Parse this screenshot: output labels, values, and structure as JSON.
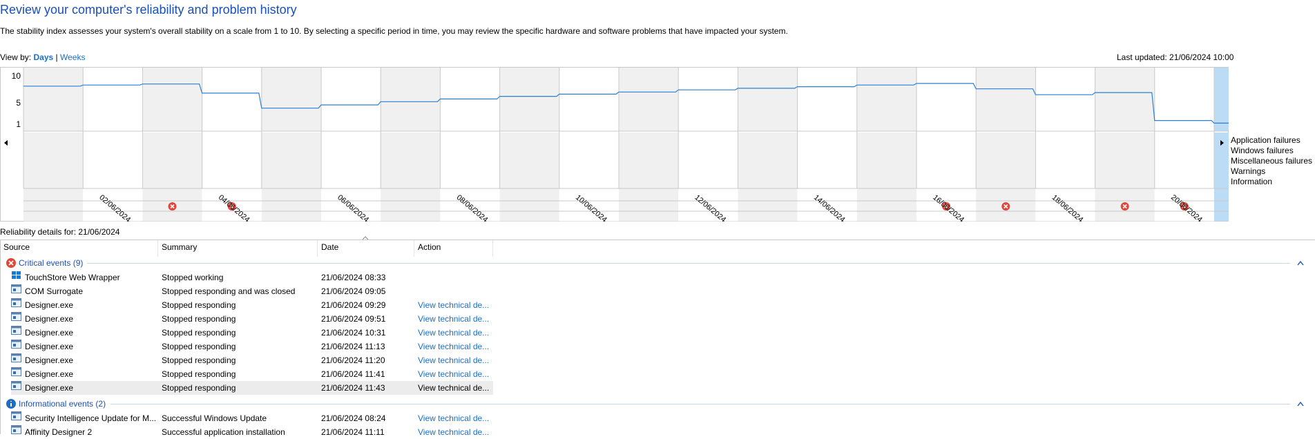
{
  "title": "Review your computer's reliability and problem history",
  "description": "The stability index assesses your system's overall stability on a scale from 1 to 10. By selecting a specific period in time, you may review the specific hardware and software problems that have impacted your system.",
  "view_by": {
    "label": "View by:",
    "days": "Days",
    "separator": "|",
    "weeks": "Weeks",
    "selected": "Days"
  },
  "last_updated": "Last updated: 21/06/2024 10:00",
  "chart": {
    "y_ticks": [
      "10",
      "5",
      "1"
    ],
    "categories": [
      "Application failures",
      "Windows failures",
      "Miscellaneous failures",
      "Warnings",
      "Information"
    ],
    "date_labels": [
      "02/06/2024",
      "04/06/2024",
      "06/06/2024",
      "08/06/2024",
      "10/06/2024",
      "12/06/2024",
      "14/06/2024",
      "16/06/2024",
      "18/06/2024",
      "20/06/2024"
    ]
  },
  "chart_data": {
    "type": "line",
    "ylim": [
      1,
      10
    ],
    "x": [
      "01/06/2024",
      "02/06/2024",
      "03/06/2024",
      "04/06/2024",
      "05/06/2024",
      "06/06/2024",
      "07/06/2024",
      "08/06/2024",
      "09/06/2024",
      "10/06/2024",
      "11/06/2024",
      "12/06/2024",
      "13/06/2024",
      "14/06/2024",
      "15/06/2024",
      "16/06/2024",
      "17/06/2024",
      "18/06/2024",
      "19/06/2024",
      "20/06/2024",
      "21/06/2024"
    ],
    "stability": [
      8.1,
      8.3,
      8.5,
      6.8,
      4.0,
      4.6,
      5.2,
      5.7,
      6.2,
      6.6,
      7.0,
      7.4,
      7.7,
      8.0,
      8.3,
      8.6,
      7.6,
      6.5,
      6.9,
      1.7,
      1.2
    ],
    "selected_day": "21/06/2024",
    "application_failures": [
      "03/06/2024",
      "04/06/2024",
      "16/06/2024",
      "17/06/2024",
      "19/06/2024",
      "20/06/2024"
    ],
    "windows_failures": [],
    "miscellaneous_failures": [],
    "warnings": [
      "04/06/2024"
    ],
    "information": [
      "03/06/2024",
      "04/06/2024",
      "05/06/2024",
      "08/06/2024",
      "09/06/2024",
      "10/06/2024",
      "11/06/2024",
      "12/06/2024",
      "16/06/2024",
      "17/06/2024",
      "18/06/2024",
      "19/06/2024",
      "20/06/2024"
    ]
  },
  "details_title": "Reliability details for: 21/06/2024",
  "columns": [
    "Source",
    "Summary",
    "Date",
    "Action"
  ],
  "groups": [
    {
      "label": "Critical events (9)",
      "icon": "critical-icon",
      "rows": [
        {
          "icon": "store-app-icon",
          "source": "TouchStore Web Wrapper",
          "summary": "Stopped working",
          "date": "21/06/2024 08:33",
          "action": ""
        },
        {
          "icon": "app-window-icon",
          "source": "COM Surrogate",
          "summary": "Stopped responding and was closed",
          "date": "21/06/2024 09:05",
          "action": ""
        },
        {
          "icon": "app-window-icon",
          "source": "Designer.exe",
          "summary": "Stopped responding",
          "date": "21/06/2024 09:29",
          "action": "View technical de..."
        },
        {
          "icon": "app-window-icon",
          "source": "Designer.exe",
          "summary": "Stopped responding",
          "date": "21/06/2024 09:51",
          "action": "View technical de..."
        },
        {
          "icon": "app-window-icon",
          "source": "Designer.exe",
          "summary": "Stopped responding",
          "date": "21/06/2024 10:31",
          "action": "View technical de..."
        },
        {
          "icon": "app-window-icon",
          "source": "Designer.exe",
          "summary": "Stopped responding",
          "date": "21/06/2024 11:13",
          "action": "View technical de..."
        },
        {
          "icon": "app-window-icon",
          "source": "Designer.exe",
          "summary": "Stopped responding",
          "date": "21/06/2024 11:20",
          "action": "View technical de..."
        },
        {
          "icon": "app-window-icon",
          "source": "Designer.exe",
          "summary": "Stopped responding",
          "date": "21/06/2024 11:41",
          "action": "View technical de..."
        },
        {
          "icon": "app-window-icon",
          "source": "Designer.exe",
          "summary": "Stopped responding",
          "date": "21/06/2024 11:43",
          "action": "View technical de...",
          "highlighted": true
        }
      ]
    },
    {
      "label": "Informational events (2)",
      "icon": "info-icon",
      "rows": [
        {
          "icon": "app-window-icon",
          "source": "Security Intelligence Update for M...",
          "summary": "Successful Windows Update",
          "date": "21/06/2024 08:24",
          "action": "View technical de..."
        },
        {
          "icon": "app-window-icon",
          "source": "Affinity Designer 2",
          "summary": "Successful application installation",
          "date": "21/06/2024 11:11",
          "action": "View technical de..."
        }
      ]
    }
  ],
  "colors": {
    "title": "#1a50b6",
    "link": "#1a6fc8",
    "line": "#2a7fd4",
    "selected": "#bcdcf5",
    "shaded": "#f0f0f0",
    "critical": "#e0473a",
    "warning": "#f4c21d",
    "info": "#1e6fc4"
  }
}
